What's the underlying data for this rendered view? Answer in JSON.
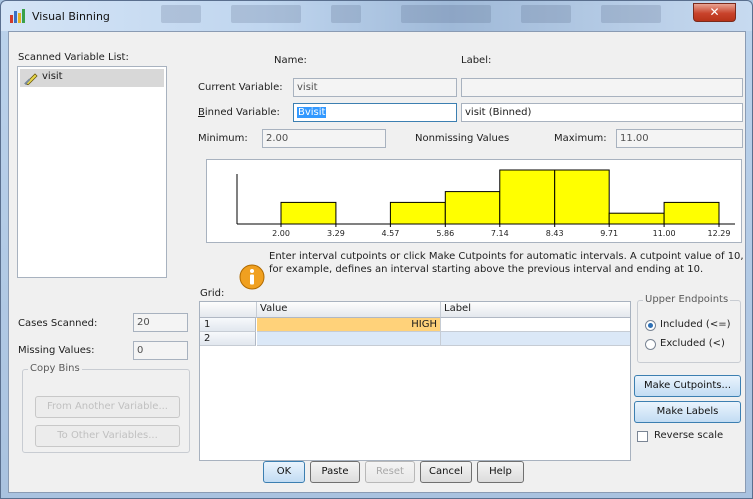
{
  "window": {
    "title": "Visual Binning",
    "close_glyph": "✕"
  },
  "left": {
    "scanned_label": "Scanned Variable List:",
    "variables": [
      {
        "name": "visit",
        "icon": "ruler-pencil-icon"
      }
    ],
    "cases_scanned_label": "Cases Scanned:",
    "cases_scanned_value": "20",
    "missing_label": "Missing Values:",
    "missing_value": "0",
    "copy_bins_label": "Copy Bins",
    "from_another_label": "From Another Variable...",
    "to_other_label": "To Other Variables..."
  },
  "header": {
    "name_label": "Name:",
    "label_label": "Label:"
  },
  "current": {
    "label": "Current Variable:",
    "name": "visit",
    "label_value": ""
  },
  "binned": {
    "label": "Binned Variable:",
    "name": "Bvisit",
    "label_value": "visit (Binned)"
  },
  "stats": {
    "minimum_label": "Minimum:",
    "minimum": "2.00",
    "nonmissing_label": "Nonmissing Values",
    "maximum_label": "Maximum:",
    "maximum": "11.00"
  },
  "chart_data": {
    "type": "bar",
    "ticks": [
      "2.00",
      "3.29",
      "4.57",
      "5.86",
      "7.14",
      "8.43",
      "9.71",
      "11.00",
      "12.29"
    ],
    "bins": [
      {
        "start": 2.0,
        "end": 3.29,
        "count": 2
      },
      {
        "start": 3.29,
        "end": 4.57,
        "count": 0
      },
      {
        "start": 4.57,
        "end": 5.86,
        "count": 2
      },
      {
        "start": 5.86,
        "end": 7.14,
        "count": 3
      },
      {
        "start": 7.14,
        "end": 8.43,
        "count": 5
      },
      {
        "start": 8.43,
        "end": 9.71,
        "count": 5
      },
      {
        "start": 9.71,
        "end": 11.0,
        "count": 1
      },
      {
        "start": 11.0,
        "end": 12.29,
        "count": 2
      }
    ],
    "ylim": [
      0,
      5
    ],
    "colors": {
      "bar": "#ffff00",
      "outline": "#000000"
    }
  },
  "info": {
    "text": "Enter interval cutpoints or click Make Cutpoints for automatic intervals. A cutpoint value of 10, for example, defines an interval starting above the previous interval and ending at 10."
  },
  "grid": {
    "label": "Grid:",
    "columns": [
      "Value",
      "Label"
    ],
    "rows": [
      {
        "num": "1",
        "value": "HIGH",
        "label": ""
      },
      {
        "num": "2",
        "value": "",
        "label": ""
      }
    ]
  },
  "endpoints": {
    "legend": "Upper Endpoints",
    "included": "Included (<=)",
    "excluded": "Excluded (<)",
    "selected": "included"
  },
  "buttons": {
    "make_cutpoints": "Make Cutpoints...",
    "make_labels": "Make Labels",
    "reverse_scale": "Reverse scale",
    "ok": "OK",
    "paste": "Paste",
    "reset": "Reset",
    "cancel": "Cancel",
    "help": "Help"
  }
}
